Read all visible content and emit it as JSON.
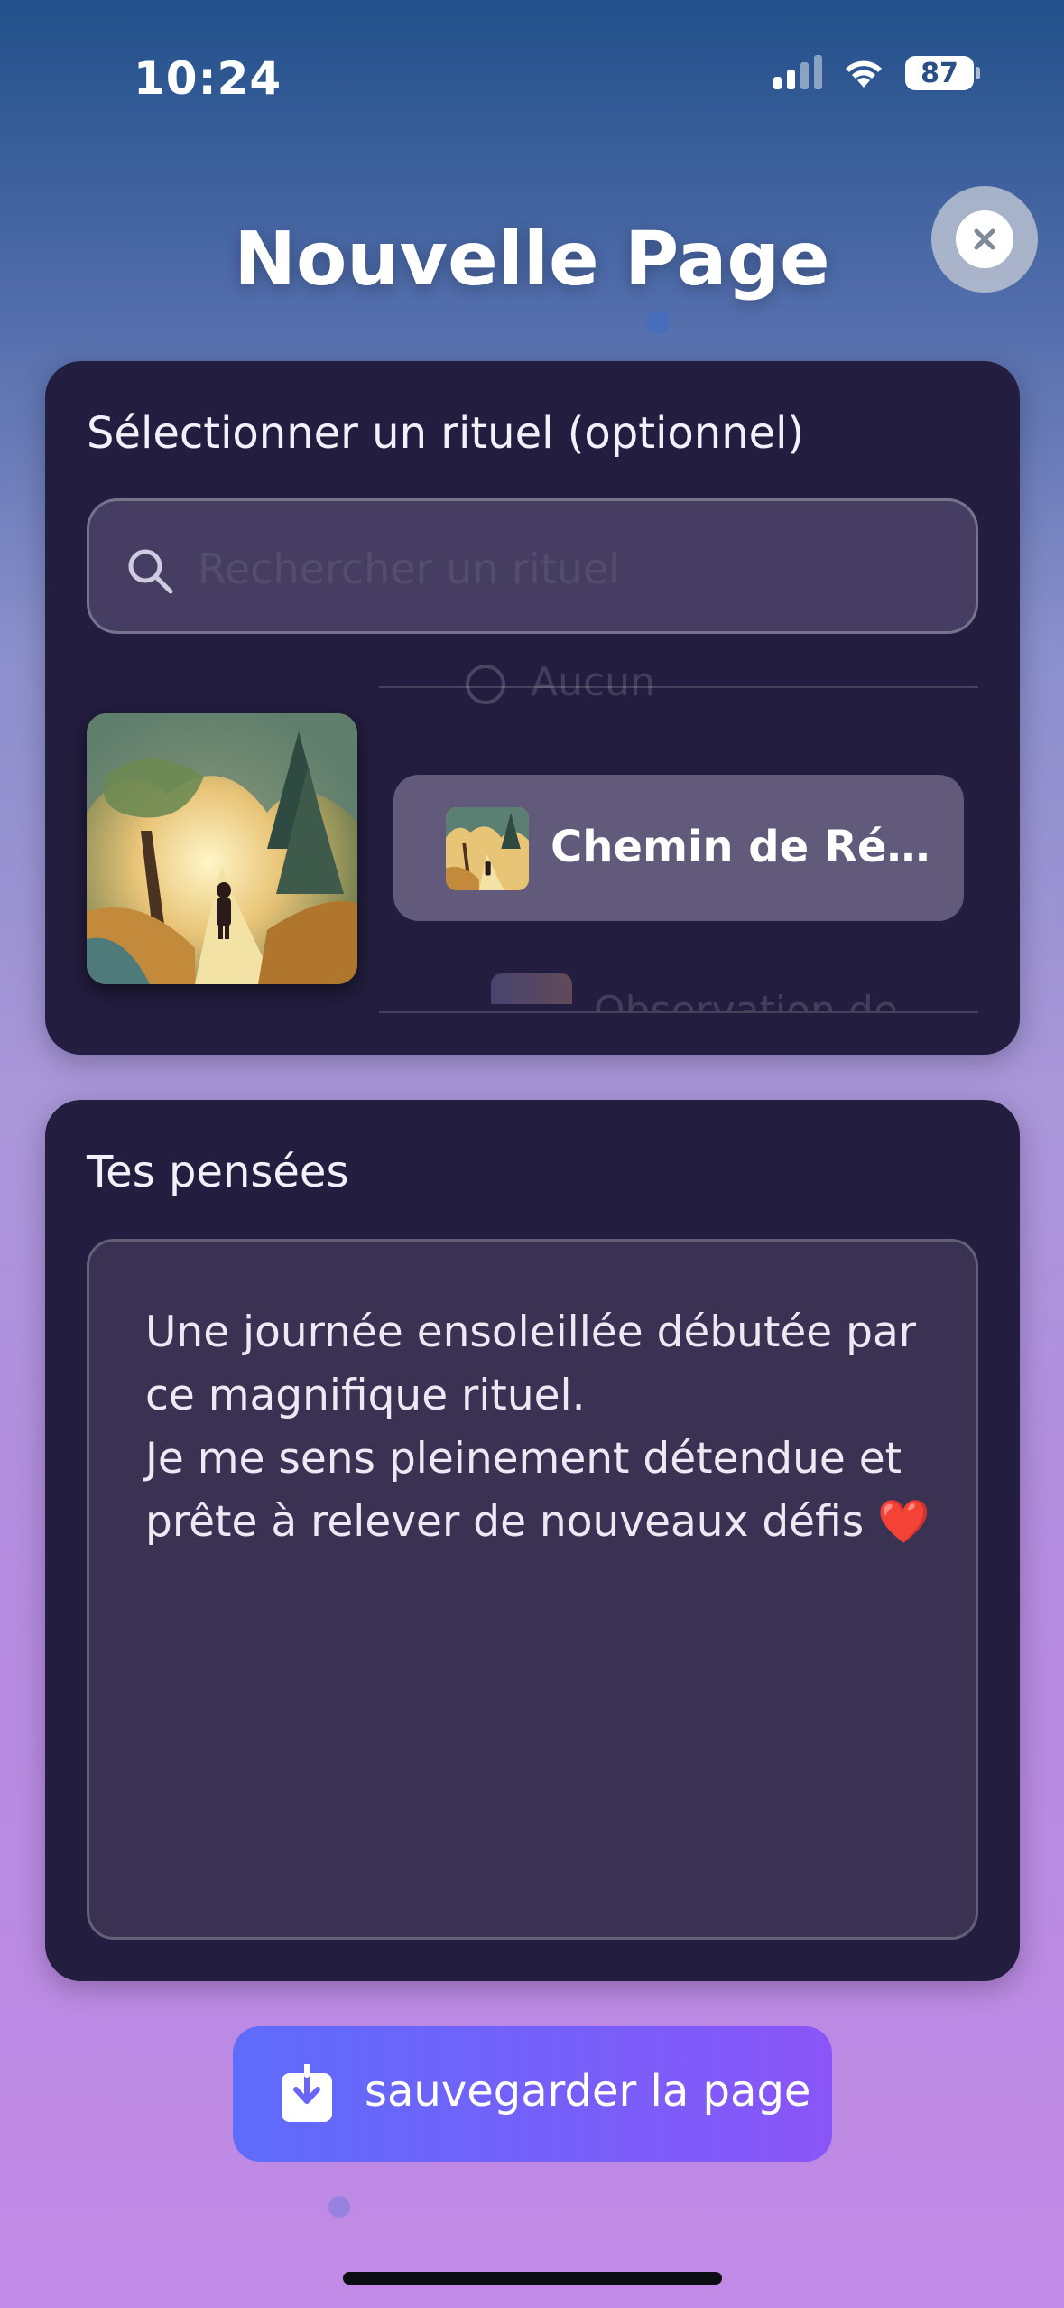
{
  "status_bar": {
    "time": "10:24",
    "battery": "87"
  },
  "header": {
    "title": "Nouvelle Page"
  },
  "ritual_card": {
    "label": "Sélectionner un rituel (optionnel)",
    "search_placeholder": "Rechercher un rituel",
    "picker": {
      "previous_item": "Aucun",
      "selected_item": "Chemin de Ré…",
      "next_item": "Observation de"
    }
  },
  "thoughts_card": {
    "label": "Tes pensées",
    "text": "Une journée ensoleillée débutée par ce magnifique rituel.\nJe me sens pleinement détendue et prête à relever de nouveaux défis",
    "emoji": "❤️"
  },
  "actions": {
    "save_label": "sauvegarder la page"
  },
  "colors": {
    "card_bg": "#231d3f",
    "button_start": "#5d6cfb",
    "button_end": "#8a55f7"
  },
  "icons": {
    "close": "close-icon",
    "search": "search-icon",
    "save": "download-icon"
  }
}
